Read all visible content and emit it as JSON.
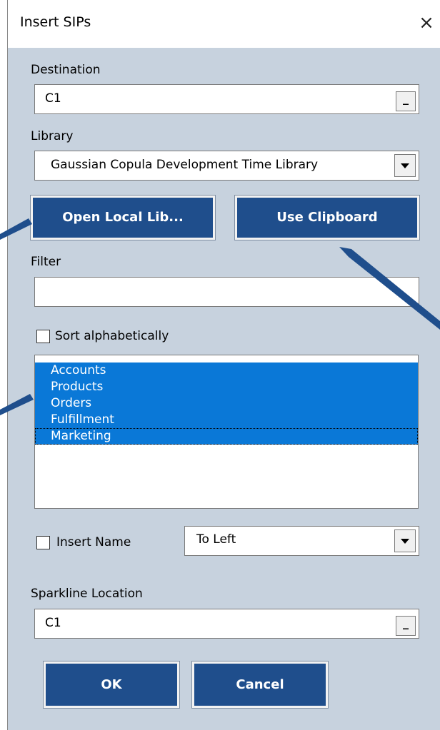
{
  "window": {
    "title": "Insert SIPs",
    "close_icon": "×"
  },
  "destination": {
    "label": "Destination",
    "value": "C1",
    "button": "_"
  },
  "library": {
    "label": "Library",
    "value": "Gaussian Copula Development Time Library"
  },
  "buttons": {
    "open_local": "Open Local Lib...",
    "use_clipboard": "Use Clipboard",
    "ok": "OK",
    "cancel": "Cancel"
  },
  "filter": {
    "label": "Filter",
    "value": ""
  },
  "sort": {
    "label": "Sort alphabetically",
    "checked": false
  },
  "list": {
    "items": [
      "Accounts",
      "Products",
      "Orders",
      "Fulfillment",
      "Marketing"
    ]
  },
  "insert_name": {
    "label": "Insert Name",
    "checked": false,
    "position": "To Left"
  },
  "sparkline": {
    "label": "Sparkline Location",
    "value": "C1",
    "button": "_"
  },
  "colors": {
    "button_bg": "#1f4e8c",
    "dialog_bg": "#c7d2de",
    "selection": "#0a78d7"
  }
}
